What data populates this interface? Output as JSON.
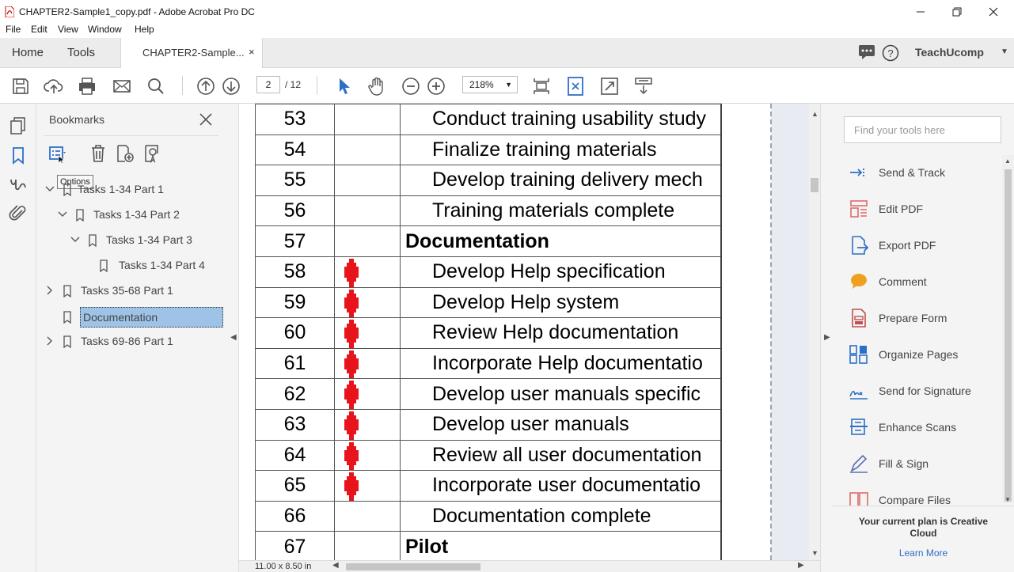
{
  "window": {
    "title": "CHAPTER2-Sample1_copy.pdf - Adobe Acrobat Pro DC"
  },
  "menu": [
    "File",
    "Edit",
    "View",
    "Window",
    "Help"
  ],
  "tabs": {
    "home": "Home",
    "tools": "Tools",
    "document": "CHAPTER2-Sample...",
    "document_close": "×",
    "user": "TeachUcomp"
  },
  "toolbar": {
    "current_page": "2",
    "total_pages": "/ 12",
    "zoom": "218%"
  },
  "bookmarks": {
    "header": "Bookmarks",
    "tooltip": "Options",
    "items": [
      {
        "label": "Tasks 1-34 Part 1",
        "expanded": true
      },
      {
        "label": "Tasks 1-34 Part 2",
        "expanded": true
      },
      {
        "label": "Tasks 1-34 Part 3",
        "expanded": true
      },
      {
        "label": "Tasks 1-34 Part 4"
      },
      {
        "label": "Tasks 35-68 Part 1",
        "expanded": false
      },
      {
        "label": "Documentation",
        "selected": true
      },
      {
        "label": "Tasks 69-86 Part 1",
        "expanded": false
      }
    ]
  },
  "document": {
    "rows": [
      {
        "num": "53",
        "name": "Conduct training usability study",
        "marker": false
      },
      {
        "num": "54",
        "name": "Finalize training materials",
        "marker": false
      },
      {
        "num": "55",
        "name": "Develop training delivery mech",
        "marker": false
      },
      {
        "num": "56",
        "name": "Training materials complete",
        "marker": false
      },
      {
        "num": "57",
        "name": "Documentation",
        "heading": true
      },
      {
        "num": "58",
        "name": "Develop Help specification",
        "marker": true
      },
      {
        "num": "59",
        "name": "Develop Help system",
        "marker": true
      },
      {
        "num": "60",
        "name": "Review Help documentation",
        "marker": true
      },
      {
        "num": "61",
        "name": "Incorporate Help documentatio",
        "marker": true
      },
      {
        "num": "62",
        "name": "Develop user manuals specific",
        "marker": true
      },
      {
        "num": "63",
        "name": "Develop user manuals",
        "marker": true
      },
      {
        "num": "64",
        "name": "Review all user documentation",
        "marker": true
      },
      {
        "num": "65",
        "name": "Incorporate user documentatio",
        "marker": true
      },
      {
        "num": "66",
        "name": "Documentation complete",
        "marker": false
      },
      {
        "num": "67",
        "name": "Pilot",
        "heading": true
      }
    ],
    "marker_color": "#e8141b",
    "page_size": "11.00 x 8.50 in"
  },
  "tools_pane": {
    "search_placeholder": "Find your tools here",
    "tools": [
      {
        "label": "Send & Track",
        "icon": "send-track-icon",
        "color": "#2d6fc7"
      },
      {
        "label": "Edit PDF",
        "icon": "edit-pdf-icon",
        "color": "#e06a6a"
      },
      {
        "label": "Export PDF",
        "icon": "export-pdf-icon",
        "color": "#2d6fc7"
      },
      {
        "label": "Comment",
        "icon": "comment-icon",
        "color": "#f0a020"
      },
      {
        "label": "Prepare Form",
        "icon": "prepare-form-icon",
        "color": "#c05050"
      },
      {
        "label": "Organize Pages",
        "icon": "organize-pages-icon",
        "color": "#2d6fc7"
      },
      {
        "label": "Send for Signature",
        "icon": "send-signature-icon",
        "color": "#2d6fc7"
      },
      {
        "label": "Enhance Scans",
        "icon": "enhance-scans-icon",
        "color": "#2d6fc7"
      },
      {
        "label": "Fill & Sign",
        "icon": "fill-sign-icon",
        "color": "#5a6fb0"
      },
      {
        "label": "Compare Files",
        "icon": "compare-files-icon",
        "color": "#e06a6a"
      }
    ],
    "plan_text": "Your current plan is Creative Cloud",
    "plan_link": "Learn More"
  }
}
